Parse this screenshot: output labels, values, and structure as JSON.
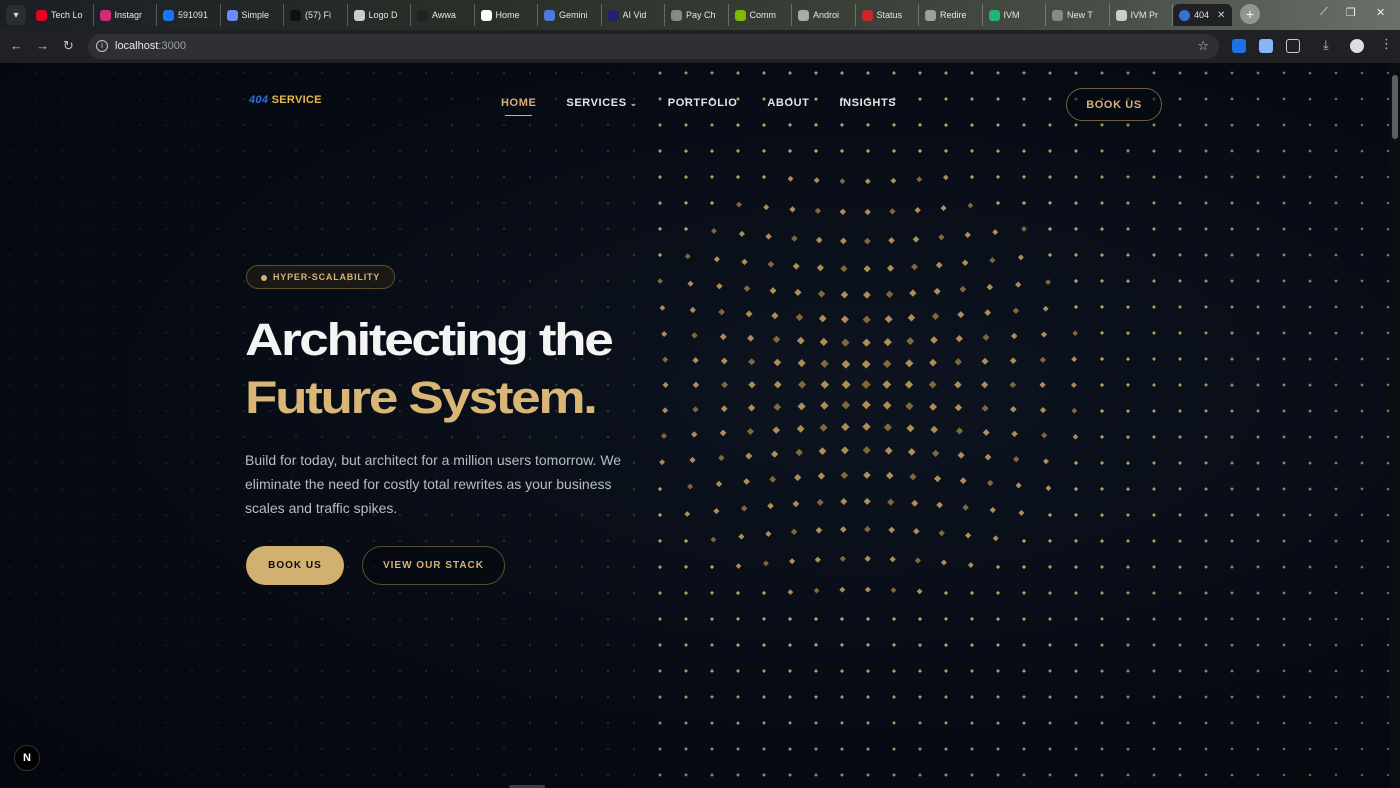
{
  "browser": {
    "tabs": [
      {
        "title": "Tech Lo",
        "color": "#e60023"
      },
      {
        "title": "Instagr",
        "color": "#d62976"
      },
      {
        "title": "591091",
        "color": "#1877f2"
      },
      {
        "title": "Simple",
        "color": "#6b8cff"
      },
      {
        "title": "(57) Fi",
        "color": "#111111"
      },
      {
        "title": "Logo D",
        "color": "#cccccc"
      },
      {
        "title": "Awwa",
        "color": "#222222"
      },
      {
        "title": "Home",
        "color": "#ffffff"
      },
      {
        "title": "Gemini",
        "color": "#4a7bd8"
      },
      {
        "title": "AI Vid",
        "color": "#222266"
      },
      {
        "title": "Pay Ch",
        "color": "#888888"
      },
      {
        "title": "Comm",
        "color": "#7fb800"
      },
      {
        "title": "Androi",
        "color": "#aaaaaa"
      },
      {
        "title": "Status",
        "color": "#c62828"
      },
      {
        "title": "Redire",
        "color": "#9e9e9e"
      },
      {
        "title": "IVM",
        "color": "#21b573"
      },
      {
        "title": "New T",
        "color": "#888888"
      },
      {
        "title": "IVM Pr",
        "color": "#cccccc"
      }
    ],
    "active_tab": {
      "title": "404",
      "color": "#3b6fd6"
    },
    "new_tab_label": "+",
    "url_host": "localhost",
    "url_port": ":3000"
  },
  "site": {
    "brand_num": "404",
    "brand_word": "SERVICE",
    "nav": [
      {
        "label": "HOME",
        "active": true
      },
      {
        "label": "SERVICES",
        "dropdown": true
      },
      {
        "label": "PORTFOLIO"
      },
      {
        "label": "ABOUT"
      },
      {
        "label": "INSIGHTS"
      }
    ],
    "nav_cta": "BOOK US",
    "hero": {
      "badge": "HYPER-SCALABILITY",
      "title_line1": "Architecting the",
      "title_line2": "Future System.",
      "lead": "Build for today, but architect for a million users tomorrow. We eliminate the need for costly total rewrites as your business scales and traffic spikes.",
      "primary_cta": "BOOK US",
      "secondary_cta": "VIEW OUR STACK"
    },
    "dev_badge": "N",
    "colors": {
      "accent": "#d2b070",
      "background": "#05080f",
      "brand_blue": "#2f6fd6"
    }
  }
}
